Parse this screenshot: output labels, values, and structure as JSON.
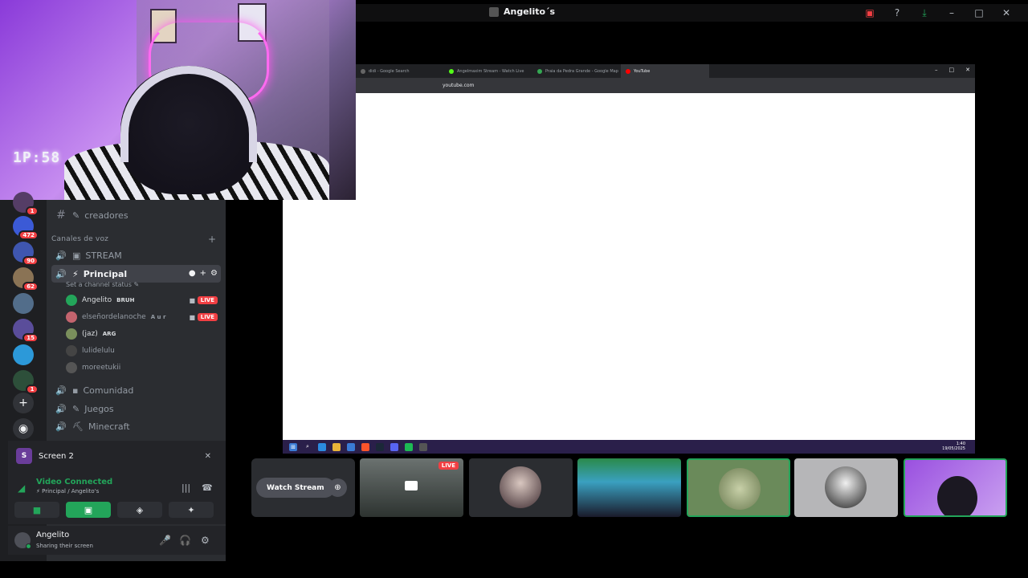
{
  "titlebar": {
    "title": "Angelito´s",
    "icons": [
      "cast-icon",
      "help-icon",
      "download-icon",
      "minimize-icon",
      "maximize-icon",
      "close-icon"
    ]
  },
  "webcam": {
    "clock_text": "1P:58"
  },
  "servers": [
    {
      "badge": "1"
    },
    {
      "badge": "472"
    },
    {
      "badge": "90"
    },
    {
      "badge": "62"
    },
    {
      "badge": ""
    },
    {
      "badge": "15"
    },
    {
      "badge": ""
    },
    {
      "badge": "1"
    }
  ],
  "sidebar": {
    "text_channel": "creadores",
    "voice_category": "Canales de voz",
    "voice_channels": {
      "stream": "STREAM",
      "principal": "Principal",
      "status": "Set a channel status",
      "comunidad": "Comunidad",
      "juegos": "Juegos",
      "minecraft": "Minecraft"
    },
    "members": [
      {
        "name": "Angelito",
        "tag": "BRUH",
        "live": "LIVE",
        "color": "#23a55a"
      },
      {
        "name": "elseñordelanoche",
        "tag": "A u r",
        "live": "LIVE",
        "color": "#c4646e"
      },
      {
        "name": "(jaz)",
        "tag": "ARG",
        "live": "",
        "color": "#7a8f5c"
      },
      {
        "name": "lulidelulu",
        "tag": "",
        "live": "",
        "color": "#444"
      },
      {
        "name": "moreetukii",
        "tag": "",
        "live": "",
        "color": "#555"
      }
    ]
  },
  "screen_panel": {
    "icon": "S",
    "label": "Screen 2"
  },
  "voice_panel": {
    "connected": "Video Connected",
    "location": "Principal / Angelito's"
  },
  "user_panel": {
    "name": "Angelito",
    "status": "Sharing their screen"
  },
  "browser": {
    "tabs": [
      "didi - Google Search",
      "Angelmaxim Stream - Watch Live",
      "Praia da Pedra Grande - Google Map",
      "YouTube"
    ],
    "url": "youtube.com",
    "clock_time": "1:40",
    "clock_date": "19/05/2025"
  },
  "tiles": {
    "watch_label": "Watch Stream",
    "live_label": "LIVE"
  }
}
